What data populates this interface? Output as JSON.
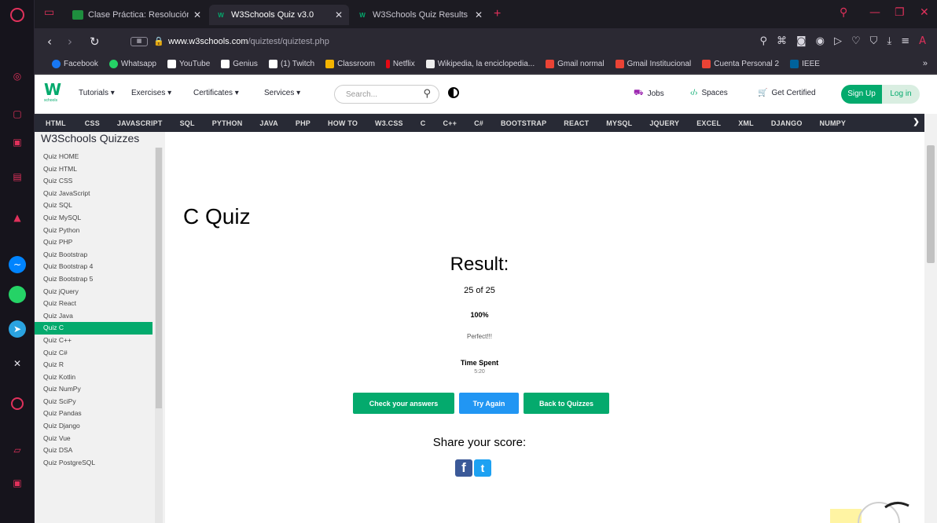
{
  "tabs": [
    {
      "label": "Clase Práctica: Resolución",
      "favicon": "classroom-favicon",
      "color": "#1e8e3e"
    },
    {
      "label": "W3Schools Quiz v3.0",
      "favicon": "w3schools-favicon",
      "color": "#04aa6d"
    },
    {
      "label": "W3Schools Quiz Results",
      "favicon": "w3schools-favicon",
      "color": "#04aa6d"
    }
  ],
  "address": {
    "url_host": "www.w3schools.com",
    "url_path": "/quiztest/quiztest.php"
  },
  "bookmarks": [
    {
      "label": "Facebook",
      "color": "#1877f2"
    },
    {
      "label": "Whatsapp",
      "color": "#25d366"
    },
    {
      "label": "YouTube",
      "color": "#ffffff"
    },
    {
      "label": "Genius",
      "color": "#ffffff"
    },
    {
      "label": "(1) Twitch",
      "color": "#ffffff"
    },
    {
      "label": "Classroom",
      "color": "#f4b400"
    },
    {
      "label": "Netflix",
      "color": "#e50914"
    },
    {
      "label": "Wikipedia, la enciclopedia...",
      "color": "#eeeeee"
    },
    {
      "label": "Gmail normal",
      "color": "#ea4335"
    },
    {
      "label": "Gmail Institucional",
      "color": "#ea4335"
    },
    {
      "label": "Cuenta Personal 2",
      "color": "#ea4335"
    },
    {
      "label": "IEEE",
      "color": "#00629b"
    }
  ],
  "w3nav": {
    "logo": "W",
    "logo_sub": "schools",
    "menus": [
      "Tutorials ▾",
      "Exercises ▾",
      "Certificates ▾",
      "Services ▾"
    ],
    "search_placeholder": "Search...",
    "jobs": "Jobs",
    "spaces": "Spaces",
    "certified": "Get Certified",
    "signup": "Sign Up",
    "login": "Log in"
  },
  "topics": [
    "HTML",
    "CSS",
    "JAVASCRIPT",
    "SQL",
    "PYTHON",
    "JAVA",
    "PHP",
    "HOW TO",
    "W3.CSS",
    "C",
    "C++",
    "C#",
    "BOOTSTRAP",
    "REACT",
    "MYSQL",
    "JQUERY",
    "EXCEL",
    "XML",
    "DJANGO",
    "NUMPY"
  ],
  "quiz_nav": {
    "title": "W3Schools Quizzes",
    "items": [
      "Quiz HOME",
      "Quiz HTML",
      "Quiz CSS",
      "Quiz JavaScript",
      "Quiz SQL",
      "Quiz MySQL",
      "Quiz Python",
      "Quiz PHP",
      "Quiz Bootstrap",
      "Quiz Bootstrap 4",
      "Quiz Bootstrap 5",
      "Quiz jQuery",
      "Quiz React",
      "Quiz Java",
      "Quiz C",
      "Quiz C++",
      "Quiz C#",
      "Quiz R",
      "Quiz Kotlin",
      "Quiz NumPy",
      "Quiz SciPy",
      "Quiz Pandas",
      "Quiz Django",
      "Quiz Vue",
      "Quiz DSA",
      "Quiz PostgreSQL"
    ],
    "active_index": 14
  },
  "main": {
    "title": "C Quiz",
    "result_heading": "Result:",
    "score": "25 of 25",
    "percent": "100%",
    "message": "Perfect!!!",
    "time_label": "Time Spent",
    "time_value": "5:20",
    "btn_check": "Check your answers",
    "btn_try": "Try Again",
    "btn_back": "Back to Quizzes",
    "share": "Share your score:",
    "facebook_glyph": "f",
    "twitter_glyph": "t"
  },
  "colors": {
    "accent": "#04aa6d",
    "blue": "#2196f3",
    "opera_red": "#e0315b"
  }
}
